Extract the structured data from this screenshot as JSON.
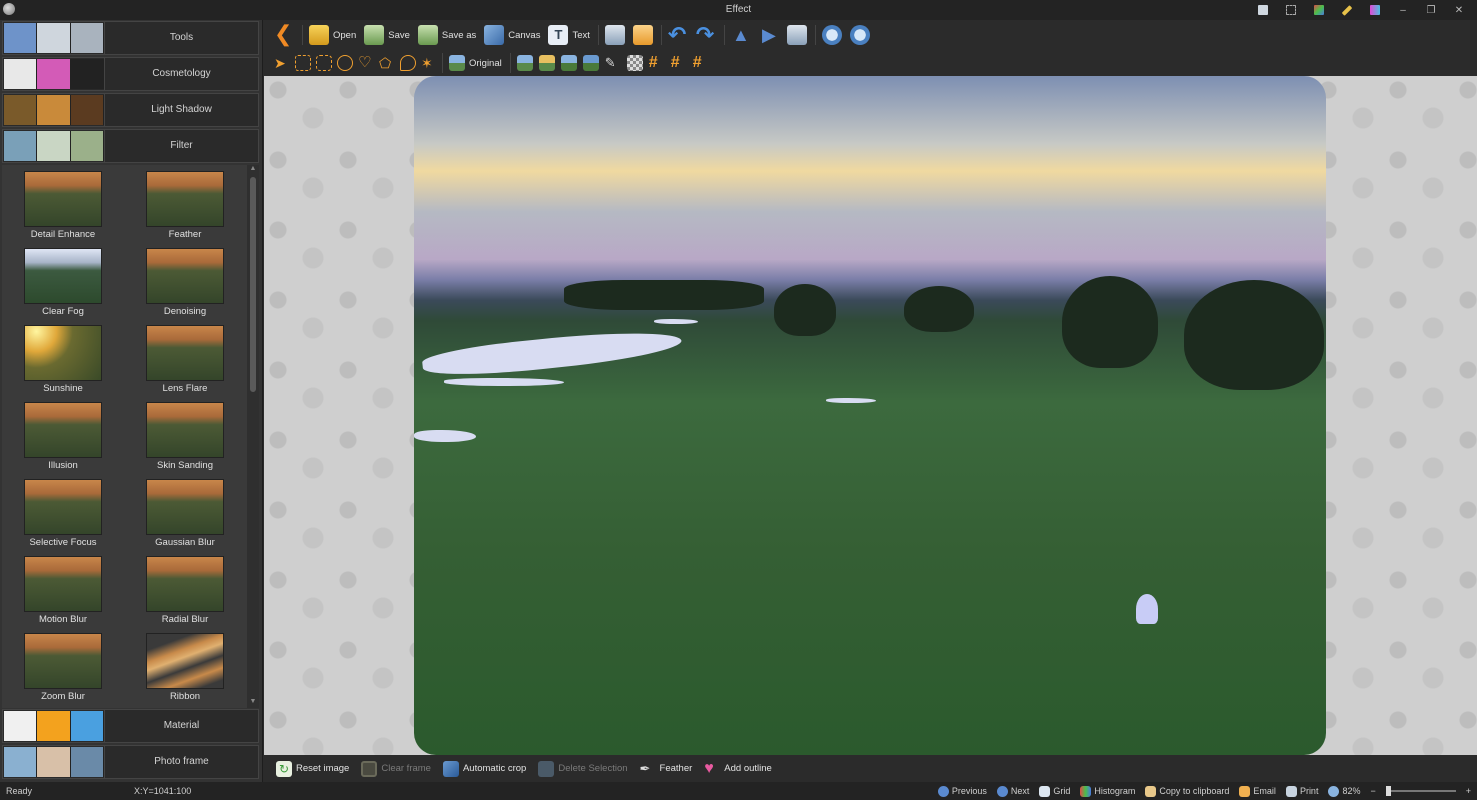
{
  "window": {
    "title": "Effect"
  },
  "categories": [
    {
      "label": "Tools",
      "colors": [
        "#6e93c9",
        "#cfd6dd",
        "#a9b3be"
      ]
    },
    {
      "label": "Cosmetology",
      "colors": [
        "#e8e8e8",
        "#d35bb7",
        "#222222"
      ]
    },
    {
      "label": "Light Shadow",
      "colors": [
        "#7a5a2a",
        "#c98a3a",
        "#5b3b20"
      ]
    },
    {
      "label": "Filter",
      "colors": [
        "#7aa0b8",
        "#c9d6c4",
        "#9bb08a"
      ]
    }
  ],
  "filters": [
    {
      "name": "Detail Enhance"
    },
    {
      "name": "Feather"
    },
    {
      "name": "Clear Fog"
    },
    {
      "name": "Denoising"
    },
    {
      "name": "Sunshine"
    },
    {
      "name": "Lens Flare"
    },
    {
      "name": "Illusion"
    },
    {
      "name": "Skin Sanding"
    },
    {
      "name": "Selective Focus"
    },
    {
      "name": "Gaussian Blur"
    },
    {
      "name": "Motion Blur"
    },
    {
      "name": "Radial Blur"
    },
    {
      "name": "Zoom Blur"
    },
    {
      "name": "Ribbon"
    }
  ],
  "bottom_categories": [
    {
      "label": "Material",
      "colors": [
        "#f0f0f0",
        "#f3a21e",
        "#4aa0e0"
      ]
    },
    {
      "label": "Photo frame",
      "colors": [
        "#8ab0d0",
        "#d8c0a8",
        "#6a8aa8"
      ]
    }
  ],
  "toolbar": {
    "open": "Open",
    "save": "Save",
    "save_as": "Save as",
    "canvas": "Canvas",
    "text": "Text",
    "original": "Original"
  },
  "actions": {
    "reset_image": "Reset image",
    "clear_frame": "Clear frame",
    "automatic_crop": "Automatic crop",
    "delete_selection": "Delete Selection",
    "feather": "Feather",
    "add_outline": "Add outline"
  },
  "status": {
    "ready": "Ready",
    "coords": "X:Y=1041:100",
    "previous": "Previous",
    "next": "Next",
    "grid": "Grid",
    "histogram": "Histogram",
    "copy": "Copy to clipboard",
    "email": "Email",
    "print": "Print",
    "zoom": "82%",
    "zoom_minus": "−",
    "zoom_plus": "+"
  }
}
